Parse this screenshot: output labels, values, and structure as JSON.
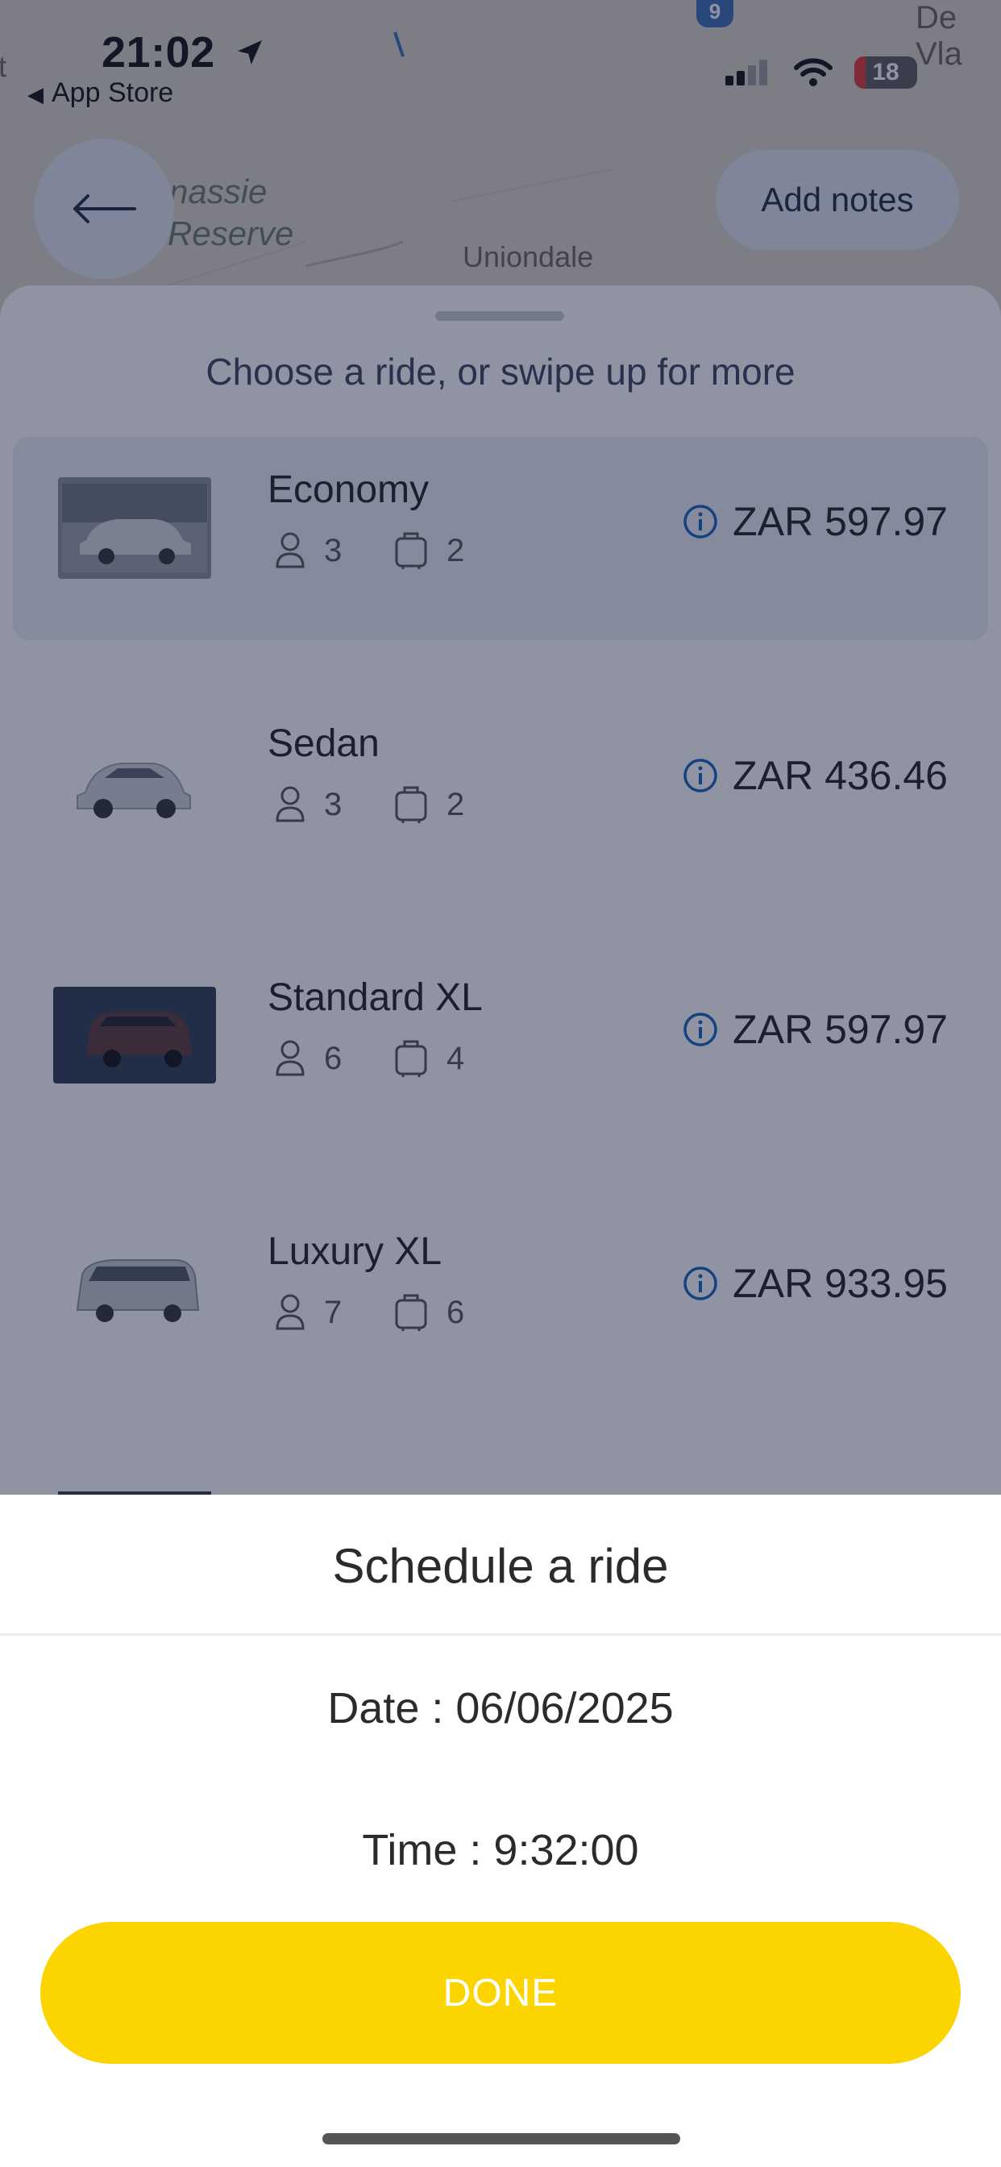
{
  "status_bar": {
    "time": "21:02",
    "back_app": "App Store",
    "battery_level": "18"
  },
  "map": {
    "labels": [
      "nassie",
      "Reserve",
      "Uniondale",
      "De Vla",
      "t"
    ],
    "road_shield": "9"
  },
  "header": {
    "add_notes_label": "Add notes"
  },
  "sheet": {
    "hint": "Choose a ride, or swipe up for more",
    "rides": [
      {
        "name": "Economy",
        "passengers": "3",
        "luggage": "2",
        "price": "ZAR 597.97",
        "selected": true
      },
      {
        "name": "Sedan",
        "passengers": "3",
        "luggage": "2",
        "price": "ZAR 436.46",
        "selected": false
      },
      {
        "name": "Standard XL",
        "passengers": "6",
        "luggage": "4",
        "price": "ZAR 597.97",
        "selected": false
      },
      {
        "name": "Luxury XL",
        "passengers": "7",
        "luggage": "6",
        "price": "ZAR 933.95",
        "selected": false
      }
    ]
  },
  "schedule": {
    "title": "Schedule a ride",
    "date": "Date : 06/06/2025",
    "time": "Time : 9:32:00",
    "done_label": "DONE"
  },
  "colors": {
    "accent": "#fcd500",
    "info_icon": "#1565c0",
    "dim_overlay": "#142040",
    "battery_low": "#e53935"
  },
  "icons": [
    "location-arrow-icon",
    "signal-icon",
    "wifi-icon",
    "battery-icon",
    "back-arrow-icon",
    "person-icon",
    "luggage-icon",
    "info-icon"
  ]
}
